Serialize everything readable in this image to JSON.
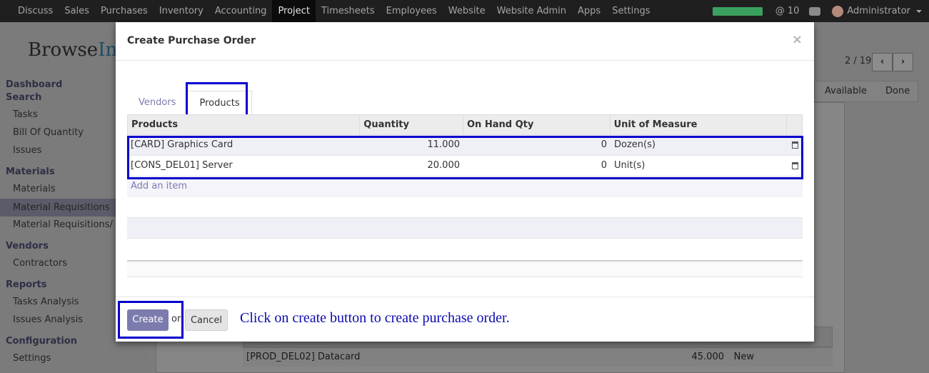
{
  "topbar": {
    "menu": [
      "Discuss",
      "Sales",
      "Purchases",
      "Inventory",
      "Accounting",
      "Project",
      "Timesheets",
      "Employees",
      "Website",
      "Website Admin",
      "Apps",
      "Settings"
    ],
    "active_index": 5,
    "message_count": "10",
    "user": "Administrator",
    "progress": 1.0
  },
  "sidebar": {
    "brand_a": "Browse",
    "brand_b": "Inf",
    "sections": [
      {
        "title": "Dashboard",
        "items": []
      },
      {
        "title": "Search",
        "items": [
          "Tasks",
          "Bill Of Quantity",
          "Issues"
        ]
      },
      {
        "title": "Materials",
        "items": [
          "Materials",
          "Material Requisitions",
          "Material Requisitions/ B..."
        ]
      },
      {
        "title": "Vendors",
        "items": [
          "Contractors"
        ]
      },
      {
        "title": "Reports",
        "items": [
          "Tasks Analysis",
          "Issues Analysis"
        ]
      },
      {
        "title": "Configuration",
        "items": [
          "Settings"
        ]
      }
    ],
    "selected_item": "Material Requisitions"
  },
  "background": {
    "pager": "2 / 19",
    "status": [
      "Available",
      "Done"
    ],
    "row": {
      "product": "[PROD_DEL02] Datacard",
      "qty": "45.000",
      "state": "New"
    }
  },
  "modal": {
    "title": "Create Purchase Order",
    "close": "×",
    "tabs": [
      "Vendors",
      "Products"
    ],
    "active_tab": 1,
    "columns": [
      "Products",
      "Quantity",
      "On Hand Qty",
      "Unit of Measure"
    ],
    "rows": [
      {
        "product": "[CARD] Graphics Card",
        "qty": "11.000",
        "onhand": "0",
        "uom": "Dozen(s)"
      },
      {
        "product": "[CONS_DEL01] Server",
        "qty": "20.000",
        "onhand": "0",
        "uom": "Unit(s)"
      }
    ],
    "add_item": "Add an item",
    "create_label": "Create",
    "or_label": "or",
    "cancel_label": "Cancel",
    "annotation": "Click on create button to create purchase order."
  },
  "colors": {
    "highlight": "#0000cc",
    "accent": "#7c7bad"
  }
}
